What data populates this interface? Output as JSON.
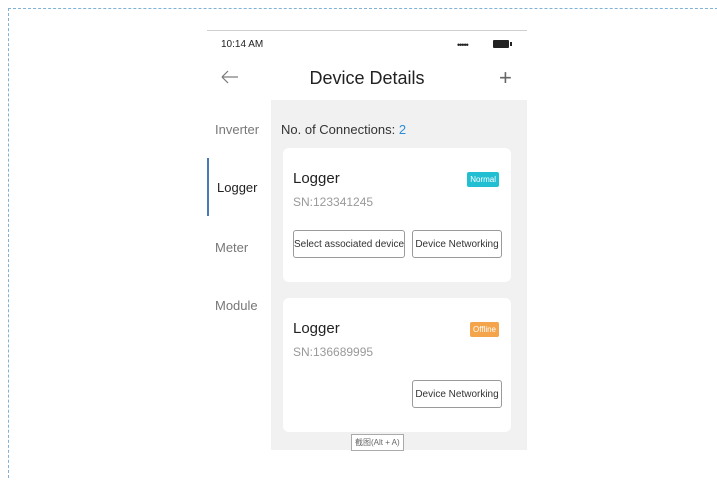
{
  "status_bar": {
    "time": "10:14 AM",
    "signal": "•••••"
  },
  "header": {
    "title": "Device Details",
    "back_icon": "arrow-left-icon",
    "add_icon": "plus-icon",
    "add_symbol": "+"
  },
  "sidebar": {
    "items": [
      {
        "label": "Inverter",
        "active": false
      },
      {
        "label": "Logger",
        "active": true
      },
      {
        "label": "Meter",
        "active": false
      },
      {
        "label": "Module",
        "active": false
      }
    ]
  },
  "main": {
    "connections_label": "No. of Connections:",
    "connections_count": "2",
    "cards": [
      {
        "title": "Logger",
        "sn": "SN:123341245",
        "status": "Normal",
        "status_color": "#22bfd3",
        "buttons": [
          "Select associated device",
          "Device Networking"
        ]
      },
      {
        "title": "Logger",
        "sn": "SN:136689995",
        "status": "Offline",
        "status_color": "#f4a44a",
        "buttons": [
          "Device Networking"
        ]
      }
    ]
  },
  "tooltip": "截图(Alt + A)",
  "colors": {
    "accent": "#2a8ed6",
    "active_indicator": "#4b79b5",
    "frame_dash": "#7fb2d6"
  }
}
